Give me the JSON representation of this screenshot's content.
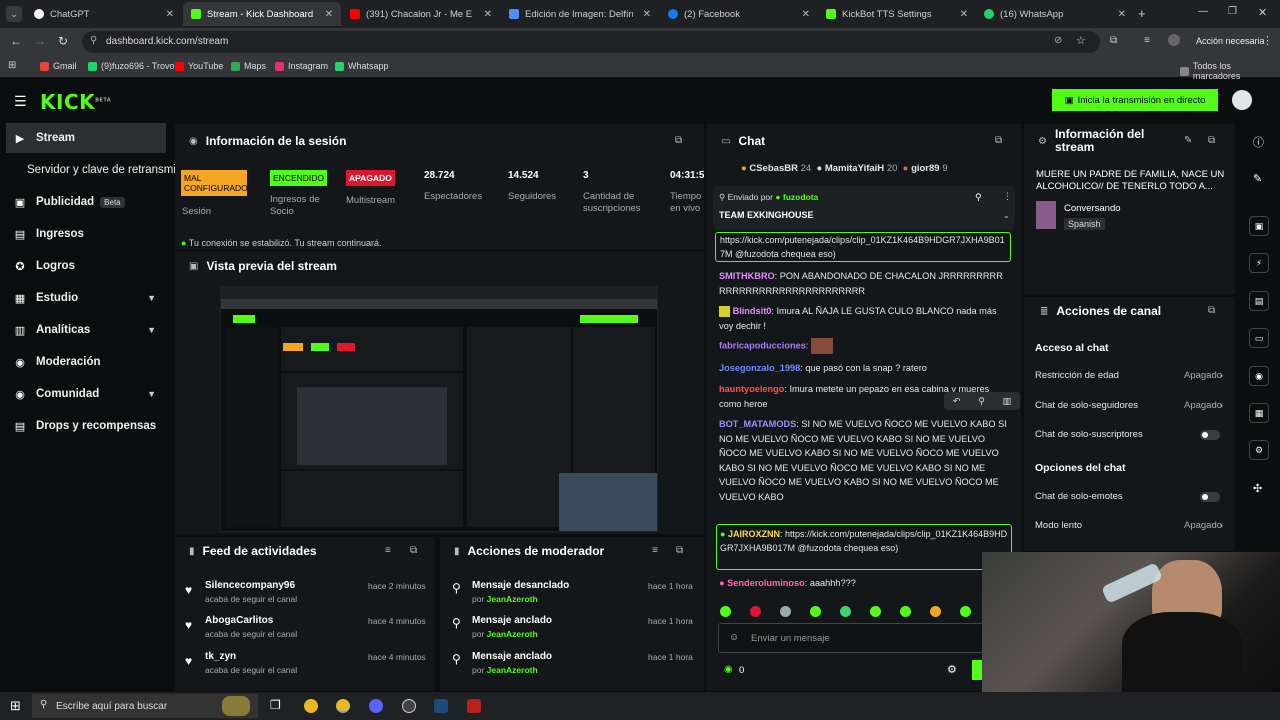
{
  "browser": {
    "tabs": [
      {
        "label": "ChatGPT",
        "color": "#ffffff"
      },
      {
        "label": "Stream - Kick Dashboard",
        "color": "#53fc18"
      },
      {
        "label": "(391) Chacalon Jr - Me Equ",
        "color": "#ff0000"
      },
      {
        "label": "Edición de Imagen: Delfín Pan",
        "color": "#4d8ef7"
      },
      {
        "label": "(2) Facebook",
        "color": "#1877f2"
      },
      {
        "label": "KickBot TTS Settings",
        "color": "#53fc18"
      },
      {
        "label": "(16) WhatsApp",
        "color": "#25d366"
      }
    ],
    "url": "dashboard.kick.com/stream",
    "profile_label": "Acción necesaria",
    "bookmarks": [
      {
        "label": "Gmail",
        "color": "#ea4335"
      },
      {
        "label": "(9)fuzo696 - Trovo",
        "color": "#19d66b"
      },
      {
        "label": "YouTube",
        "color": "#ff0000"
      },
      {
        "label": "Maps",
        "color": "#34a853"
      },
      {
        "label": "Instagram",
        "color": "#e1306c"
      },
      {
        "label": "Whatsapp",
        "color": "#25d366"
      }
    ],
    "all_bookmarks": "Todos los marcadores"
  },
  "header": {
    "logo": "KICK",
    "logo_sup": "BETA",
    "go_live": "Inicia la transmisión en directo"
  },
  "sidebar": {
    "items": [
      {
        "label": "Stream",
        "icon": "▶"
      },
      {
        "label": "Servidor y clave de retransmisión",
        "icon": ""
      },
      {
        "label": "Publicidad",
        "icon": "▣",
        "badge": "Beta"
      },
      {
        "label": "Ingresos",
        "icon": "▤"
      },
      {
        "label": "Logros",
        "icon": "✪"
      },
      {
        "label": "Estudio",
        "icon": "▦"
      },
      {
        "label": "Analíticas",
        "icon": "▥"
      },
      {
        "label": "Moderación",
        "icon": "◉"
      },
      {
        "label": "Comunidad",
        "icon": "◉"
      },
      {
        "label": "Drops y recompensas",
        "icon": "▤"
      }
    ]
  },
  "session": {
    "title": "Información de la sesión",
    "stats": [
      {
        "badge": "MAL CONFIGURADO",
        "label": "Sesión"
      },
      {
        "badge": "ENCENDIDO",
        "label": "Ingresos de Socio"
      },
      {
        "badge": "APAGADO",
        "label": "Multistream"
      },
      {
        "value": "28.724",
        "label": "Espectadores"
      },
      {
        "value": "14.524",
        "label": "Seguidores"
      },
      {
        "value": "3",
        "label": "Cantidad de suscripciones"
      },
      {
        "value": "04:31:5",
        "label": "Tiempo en vivo"
      }
    ],
    "connection": "Tu conexión se estabilizó. Tu stream continuará."
  },
  "preview": {
    "title": "Vista previa del stream"
  },
  "activity": {
    "title": "Feed de actividades",
    "items": [
      {
        "name": "Silencecompany96",
        "sub": "acaba de seguir el canal",
        "time": "hace 2 minutos"
      },
      {
        "name": "AbogaCarlitos",
        "sub": "acaba de seguir el canal",
        "time": "hace 4 minutos"
      },
      {
        "name": "tk_zyn",
        "sub": "acaba de seguir el canal",
        "time": "hace 4 minutos"
      }
    ]
  },
  "modactions": {
    "title": "Acciones de moderador",
    "items": [
      {
        "action": "Mensaje desanclado",
        "by": "por",
        "user": "JeanAzeroth",
        "time": "hace 1 hora"
      },
      {
        "action": "Mensaje anclado",
        "by": "por",
        "user": "JeanAzeroth",
        "time": "hace 1 hora"
      },
      {
        "action": "Mensaje anclado",
        "by": "por",
        "user": "JeanAzeroth",
        "time": "hace 1 hora"
      }
    ]
  },
  "chat": {
    "title": "Chat",
    "top_gifters": [
      {
        "name": "CSebasBR",
        "count": "24"
      },
      {
        "name": "MamitaYifaiH",
        "count": "20"
      },
      {
        "name": "gior89",
        "count": "9"
      }
    ],
    "pinned_by_label": "Enviado por",
    "pinned_by": "fuzodota",
    "pinned_text": "TEAM EXKINGHOUSE",
    "link_msg": "https://kick.com/putenejada/clips/clip_01KZ1K464B9HDGR7JXHA9B017M @fuzodota chequea eso)",
    "messages": [
      {
        "user": "SMITHKBRO",
        "color": "#e28cff",
        "text": "PON ABANDONADO DE CHACALON JRRRRRRRRRRRRRRRRRRRRRRRRRRRRRRR"
      },
      {
        "user": "Blindsit0",
        "color": "#e28cff",
        "text": "Imura AL ÑAJA LE GUSTA CULO BLANCO nada más voy dechir !"
      },
      {
        "user": "fabricapoducciones",
        "color": "#a97cff",
        "text": ""
      },
      {
        "user": "Josegonzalo_1998",
        "color": "#6d8cff",
        "text": "que pasó con la snap ? ratero"
      },
      {
        "user": "hauntyoelengo",
        "color": "#ff4f4f",
        "text": "Imura metete un pepazo en esa cabina y mueres como heroe"
      },
      {
        "user": "BOT_MATAMODS",
        "color": "#9b8cff",
        "text": "SI NO ME VUELVO ÑOCO ME VUELVO KABO SI NO ME VUELVO ÑOCO ME VUELVO KABO SI NO ME VUELVO ÑOCO ME VUELVO KABO SI NO ME VUELVO ÑOCO ME VUELVO KABO SI NO ME VUELVO ÑOCO ME VUELVO KABO SI NO ME VUELVO ÑOCO ME VUELVO KABO SI NO ME VUELVO ÑOCO ME VUELVO KABO"
      },
      {
        "user": "JAIROXZNN",
        "color": "#f5e04f",
        "text": "https://kick.com/putenejada/clips/clip_01KZ1K464B9HDGR7JXHA9B017M @fuzodota chequea eso)"
      },
      {
        "user": "Senderoluminoso",
        "color": "#ff6aa8",
        "text": "aaahhh???"
      }
    ],
    "input_placeholder": "Enviar un mensaje",
    "viewer_count": "0"
  },
  "streaminfo": {
    "title": "Información del stream",
    "stream_title": "MUERE UN PADRE DE FAMILIA, NACE UN ALCOHOLICO// DE TENERLO TODO A...",
    "category": "Conversando",
    "language": "Spanish"
  },
  "channel_actions": {
    "title": "Acciones de canal",
    "chat_access": "Acceso al chat",
    "rows1": [
      {
        "label": "Restricción de edad",
        "value": "Apagado",
        "type": "chev"
      },
      {
        "label": "Chat de solo-seguidores",
        "value": "Apagado",
        "type": "chev"
      },
      {
        "label": "Chat de solo-suscriptores",
        "value": "",
        "type": "toggle"
      }
    ],
    "chat_options": "Opciones del chat",
    "rows2": [
      {
        "label": "Chat de solo-emotes",
        "value": "",
        "type": "toggle"
      },
      {
        "label": "Modo lento",
        "value": "Apagado",
        "type": "chev"
      }
    ]
  },
  "taskbar": {
    "search_placeholder": "Escribe aquí para buscar"
  },
  "colors": {
    "accent": "#53fc18",
    "panel": "#141719",
    "bg": "#0b0e0f"
  }
}
